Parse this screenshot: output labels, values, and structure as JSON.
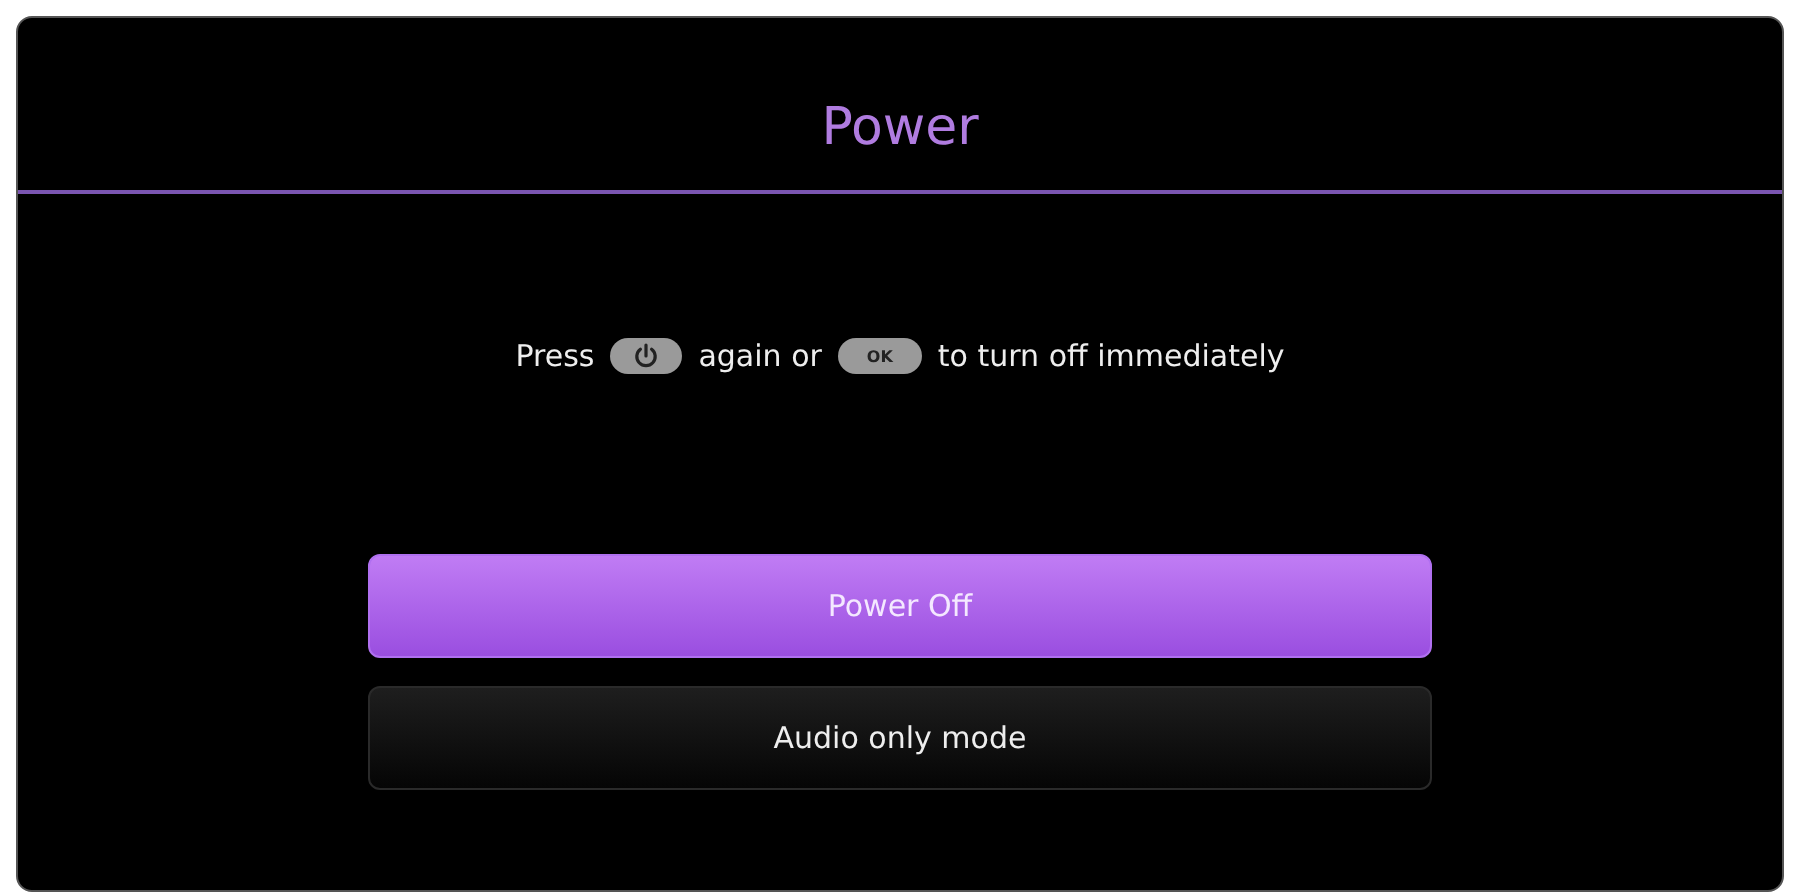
{
  "title": "Power",
  "message": [
    {
      "kind": "text",
      "text": "Press"
    },
    {
      "kind": "power_key"
    },
    {
      "kind": "text",
      "text": "again or"
    },
    {
      "kind": "key",
      "text": "OK"
    },
    {
      "kind": "text",
      "text": "to turn off immediately"
    }
  ],
  "options": [
    {
      "label": "Power Off",
      "selected": true
    },
    {
      "label": "Audio only mode",
      "selected": false
    }
  ]
}
